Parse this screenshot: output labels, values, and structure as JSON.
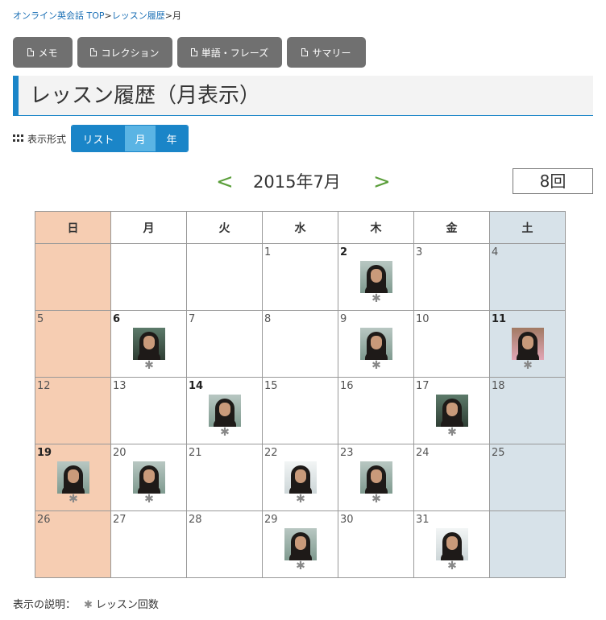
{
  "breadcrumb": {
    "link": "オンライン英会話 TOP",
    "sep1": ">",
    "history": "レッスン履歴",
    "sep2": ">",
    "current": "月"
  },
  "toolbar": {
    "memo": "メモ",
    "collection": "コレクション",
    "words": "単語・フレーズ",
    "summary": "サマリー"
  },
  "page_title": "レッスン履歴（月表示）",
  "view": {
    "label": "表示形式",
    "list": "リスト",
    "month": "月",
    "year": "年",
    "active": "月"
  },
  "calendar": {
    "prev": "<",
    "next": ">",
    "month_label": "2015年7月",
    "lesson_count": "8回",
    "weekdays": [
      "日",
      "月",
      "火",
      "水",
      "木",
      "金",
      "土"
    ],
    "weeks": [
      [
        {
          "d": ""
        },
        {
          "d": ""
        },
        {
          "d": ""
        },
        {
          "d": "1"
        },
        {
          "d": "2",
          "lesson": true,
          "bold": true,
          "tutor": "t2"
        },
        {
          "d": "3"
        },
        {
          "d": "4"
        }
      ],
      [
        {
          "d": "5"
        },
        {
          "d": "6",
          "lesson": true,
          "bold": true,
          "tutor": "t3"
        },
        {
          "d": "7"
        },
        {
          "d": "8"
        },
        {
          "d": "9",
          "lesson": true,
          "tutor": "t2"
        },
        {
          "d": "10"
        },
        {
          "d": "11",
          "lesson": true,
          "bold": true,
          "tutor": "t4"
        }
      ],
      [
        {
          "d": "12"
        },
        {
          "d": "13"
        },
        {
          "d": "14",
          "lesson": true,
          "bold": true,
          "tutor": "t2"
        },
        {
          "d": "15"
        },
        {
          "d": "16"
        },
        {
          "d": "17",
          "lesson": true,
          "tutor": "t3"
        },
        {
          "d": "18"
        }
      ],
      [
        {
          "d": "19",
          "lesson": true,
          "bold": true,
          "tutor": "t2"
        },
        {
          "d": "20",
          "lesson": true,
          "tutor": "t2"
        },
        {
          "d": "21"
        },
        {
          "d": "22",
          "lesson": true,
          "tutor": "t1"
        },
        {
          "d": "23",
          "lesson": true,
          "tutor": "t2"
        },
        {
          "d": "24"
        },
        {
          "d": "25"
        }
      ],
      [
        {
          "d": "26"
        },
        {
          "d": "27"
        },
        {
          "d": "28"
        },
        {
          "d": "29",
          "lesson": true,
          "tutor": "t2"
        },
        {
          "d": "30"
        },
        {
          "d": "31",
          "lesson": true,
          "tutor": "t1"
        },
        {
          "d": ""
        }
      ]
    ]
  },
  "legend": {
    "label": "表示の説明：",
    "item": "レッスン回数",
    "icon": "asterisk-icon"
  },
  "colors": {
    "accent": "#1a85c8",
    "sunday": "#f6cdb2",
    "saturday": "#d7e2e9",
    "button_gray": "#707070",
    "nav_arrow": "#5a9e3a"
  }
}
